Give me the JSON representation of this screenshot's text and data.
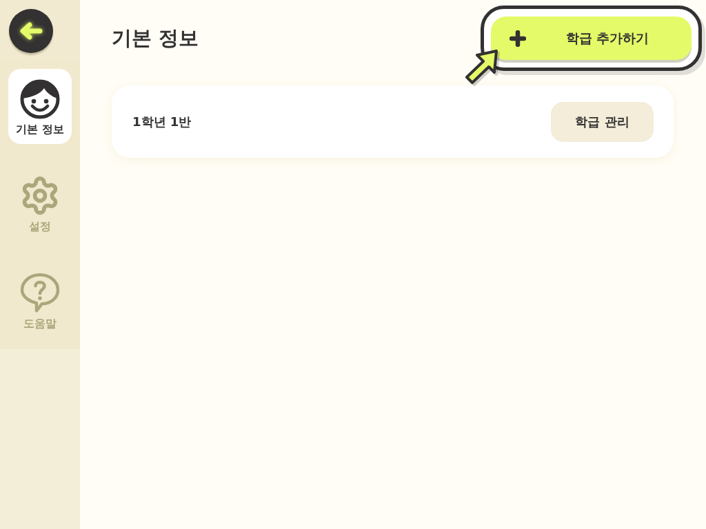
{
  "sidebar": {
    "items": [
      {
        "label": "기본 정보",
        "selected": true
      },
      {
        "label": "설정",
        "selected": false
      },
      {
        "label": "도움말",
        "selected": false
      }
    ]
  },
  "page": {
    "title": "기본 정보"
  },
  "add_class_button": {
    "label": "학급 추가하기",
    "highlighted": true
  },
  "classes": [
    {
      "name": "1학년 1반",
      "button": "학급 관리"
    }
  ]
}
